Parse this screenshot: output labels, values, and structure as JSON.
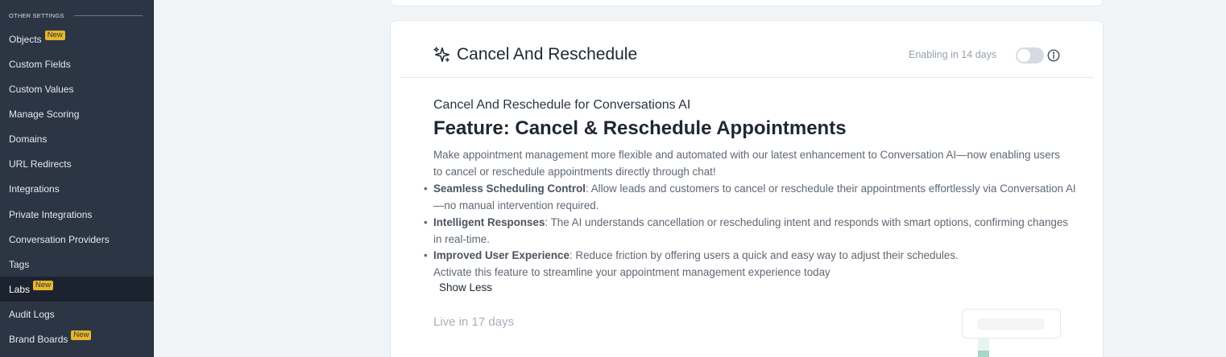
{
  "sidebar": {
    "section_label": "OTHER SETTINGS",
    "items": [
      {
        "label": "Objects",
        "badge": "New"
      },
      {
        "label": "Custom Fields"
      },
      {
        "label": "Custom Values"
      },
      {
        "label": "Manage Scoring"
      },
      {
        "label": "Domains"
      },
      {
        "label": "URL Redirects"
      },
      {
        "label": "Integrations"
      },
      {
        "label": "Private Integrations"
      },
      {
        "label": "Conversation Providers"
      },
      {
        "label": "Tags"
      },
      {
        "label": "Labs",
        "badge": "New",
        "active": true
      },
      {
        "label": "Audit Logs"
      },
      {
        "label": "Brand Boards",
        "badge": "New"
      }
    ]
  },
  "feature_card": {
    "title": "Cancel And Reschedule",
    "enable_status": "Enabling in 14 days",
    "toggle_on": false,
    "subtitle": "Cancel And Reschedule for Conversations AI",
    "heading": "Feature: Cancel & Reschedule Appointments",
    "intro": "Make appointment management more flexible and automated with our latest enhancement to Conversation AI—now enabling users to cancel or reschedule appointments directly through chat!",
    "bullets": [
      {
        "bold": "Seamless Scheduling Control",
        "text": ": Allow leads and customers to cancel or reschedule their appointments effortlessly via Conversation AI—no manual intervention required."
      },
      {
        "bold": "Intelligent Responses",
        "text": ": The AI understands cancellation or rescheduling intent and responds with smart options, confirming changes in real-time."
      },
      {
        "bold": "Improved User Experience",
        "text": ": Reduce friction by offering users a quick and easy way to adjust their schedules."
      }
    ],
    "closing": "Activate this feature to streamline your appointment management experience today",
    "show_less": "Show Less",
    "live_status": "Live in 17 days"
  }
}
